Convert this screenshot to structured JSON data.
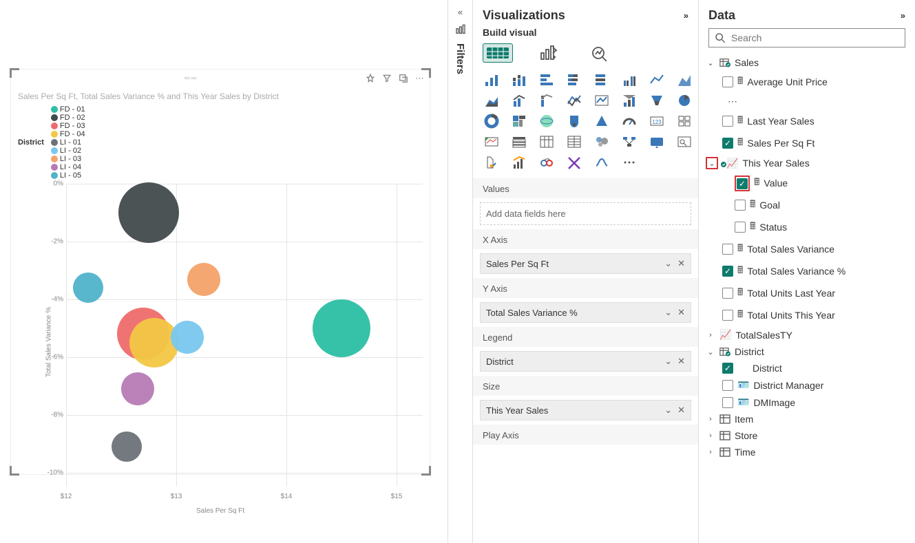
{
  "chart": {
    "title": "Sales Per Sq Ft, Total Sales Variance % and This Year Sales by District",
    "legend_label": "District",
    "xaxis_title": "Sales Per Sq Ft",
    "yaxis_title": "Total Sales Variance %"
  },
  "chart_data": {
    "type": "scatter",
    "xlabel": "Sales Per Sq Ft",
    "ylabel": "Total Sales Variance %",
    "xlim": [
      12,
      15
    ],
    "ylim": [
      -10,
      0
    ],
    "xticks": [
      "$12",
      "$13",
      "$14",
      "$15"
    ],
    "yticks": [
      "0%",
      "-2%",
      "-4%",
      "-6%",
      "-8%",
      "-10%"
    ],
    "series": [
      {
        "name": "FD - 01",
        "color": "#2bbfa3",
        "x": 14.5,
        "y": -5.0,
        "size": 42
      },
      {
        "name": "FD - 02",
        "color": "#414a4c",
        "x": 12.75,
        "y": -1.0,
        "size": 44
      },
      {
        "name": "FD - 03",
        "color": "#ef6b6b",
        "x": 12.7,
        "y": -5.2,
        "size": 38
      },
      {
        "name": "FD - 04",
        "color": "#f2c744",
        "x": 12.8,
        "y": -5.5,
        "size": 36
      },
      {
        "name": "LI - 01",
        "color": "#6d7278",
        "x": 12.55,
        "y": -9.1,
        "size": 22
      },
      {
        "name": "LI - 02",
        "color": "#79c7ef",
        "x": 13.1,
        "y": -5.3,
        "size": 24
      },
      {
        "name": "LI - 03",
        "color": "#f4a26a",
        "x": 13.25,
        "y": -3.3,
        "size": 24
      },
      {
        "name": "LI - 04",
        "color": "#b67bb5",
        "x": 12.65,
        "y": -7.1,
        "size": 24
      },
      {
        "name": "LI - 05",
        "color": "#4fb3c9",
        "x": 12.2,
        "y": -3.6,
        "size": 22
      }
    ]
  },
  "filters": {
    "label": "Filters"
  },
  "viz": {
    "title": "Visualizations",
    "subtitle": "Build visual",
    "wells": {
      "values": {
        "label": "Values",
        "placeholder": "Add data fields here"
      },
      "x": {
        "label": "X Axis",
        "value": "Sales Per Sq Ft"
      },
      "y": {
        "label": "Y Axis",
        "value": "Total Sales Variance %"
      },
      "legend": {
        "label": "Legend",
        "value": "District"
      },
      "size": {
        "label": "Size",
        "value": "This Year Sales"
      },
      "play": {
        "label": "Play Axis"
      }
    }
  },
  "data": {
    "title": "Data",
    "search_placeholder": "Search",
    "tables": {
      "sales": {
        "name": "Sales",
        "fields": {
          "aup": "Average Unit Price",
          "lys": "Last Year Sales",
          "spsf": "Sales Per Sq Ft",
          "tys": "This Year Sales",
          "value": "Value",
          "goal": "Goal",
          "status": "Status",
          "tsv": "Total Sales Variance",
          "tsvp": "Total Sales Variance %",
          "tuly": "Total Units Last Year",
          "tuty": "Total Units This Year",
          "tsty": "TotalSalesTY"
        }
      },
      "district": {
        "name": "District",
        "fields": {
          "district": "District",
          "dm": "District Manager",
          "dmi": "DMImage"
        }
      },
      "item": "Item",
      "store": "Store",
      "time": "Time"
    }
  }
}
